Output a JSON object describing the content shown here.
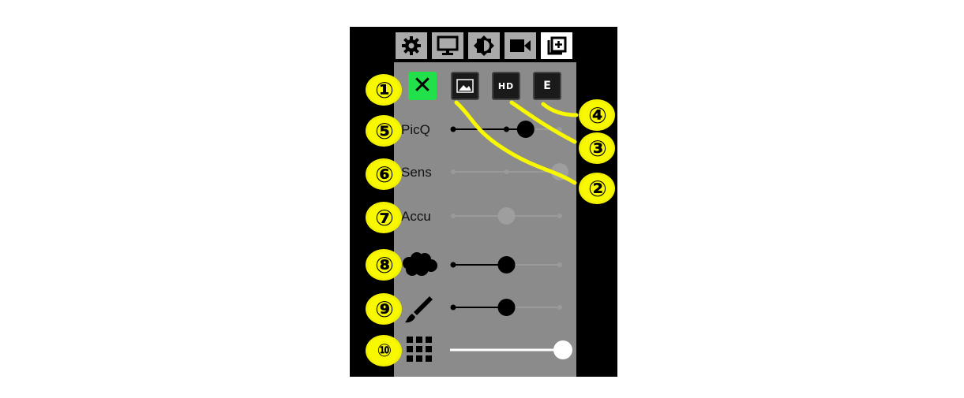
{
  "tabs": [
    {
      "icon": "gear-icon",
      "active": false
    },
    {
      "icon": "monitor-icon",
      "active": false
    },
    {
      "icon": "brightness-icon",
      "active": false
    },
    {
      "icon": "video-camera-icon",
      "active": false
    },
    {
      "icon": "photo-enhance-icon",
      "active": true
    }
  ],
  "modes": {
    "off_glyph": "✕",
    "image_icon": "image-icon",
    "hd_label": "HD",
    "e_label": "E"
  },
  "rows": {
    "picq": {
      "label": "PicQ",
      "value": 0.68,
      "enabled": true
    },
    "sens": {
      "label": "Sens",
      "value": 1.0,
      "enabled": false
    },
    "accu": {
      "label": "Accu",
      "value": 0.5,
      "enabled": false
    },
    "smooth": {
      "icon": "cloud-blob-icon",
      "value": 0.5,
      "enabled": true
    },
    "brush": {
      "icon": "paintbrush-icon",
      "value": 0.5,
      "enabled": true
    },
    "grid": {
      "icon": "grid-icon",
      "value": 1.0,
      "enabled": true
    }
  },
  "badges": [
    "①",
    "②",
    "③",
    "④",
    "⑤",
    "⑥",
    "⑦",
    "⑧",
    "⑨",
    "⑩"
  ],
  "colors": {
    "accent_green": "#22e04a",
    "annotation_yellow": "#f8f800",
    "panel": "#8b8b8b"
  }
}
